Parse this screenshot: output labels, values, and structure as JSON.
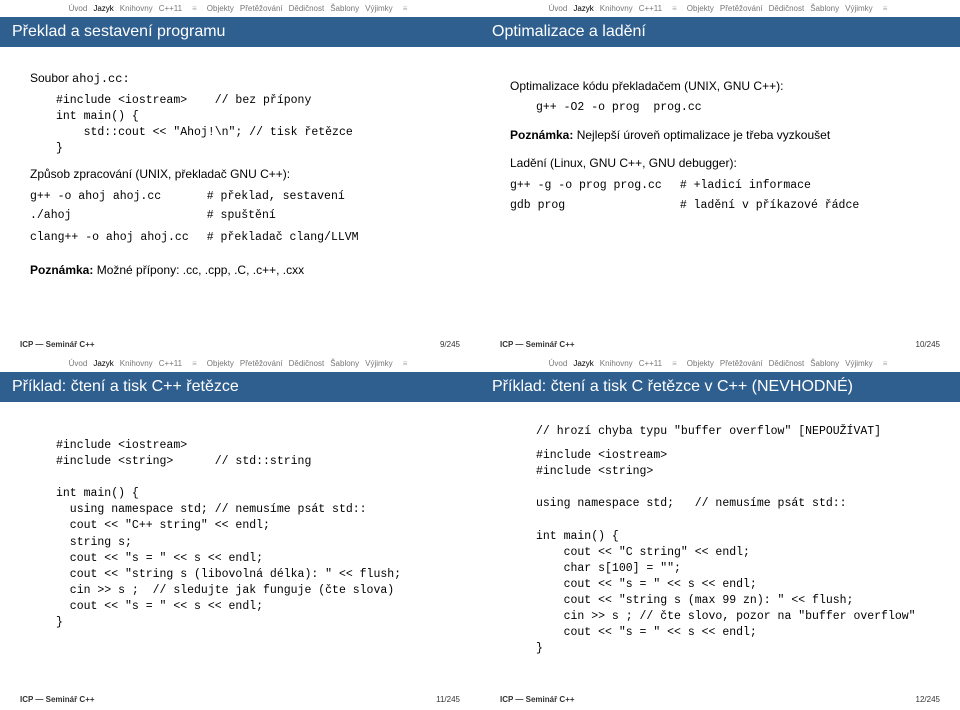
{
  "nav": {
    "items": [
      "Úvod",
      "Jazyk",
      "Knihovny",
      "C++11"
    ],
    "items2": [
      "Objekty",
      "Přetěžování",
      "Dědičnost",
      "Šablony",
      "Výjimky"
    ],
    "activeSection": "Jazyk"
  },
  "footer": {
    "left": "ICP — Seminář C++"
  },
  "slides": [
    {
      "title": "Překlad a sestavení programu",
      "soubor_label": "Soubor",
      "soubor_file": "ahoj.cc:",
      "code1": "#include <iostream>    // bez přípony\nint main() {\n    std::cout << \"Ahoj!\\n\"; // tisk řetězce\n}",
      "zpusob_label": "Způsob zpracování (UNIX, překladač GNU C++):",
      "cmds": [
        [
          "g++ -o ahoj ahoj.cc",
          "# překlad, sestavení"
        ],
        [
          "./ahoj",
          "# spuštění"
        ],
        [
          "",
          ""
        ],
        [
          "clang++ -o ahoj ahoj.cc",
          "# překladač clang/LLVM"
        ]
      ],
      "note_label": "Poznámka:",
      "note_text": "Možné přípony: .cc, .cpp, .C, .c++, .cxx",
      "page": "9/245"
    },
    {
      "title": "Optimalizace a ladění",
      "opt_label": "Optimalizace kódu překladačem (UNIX, GNU C++):",
      "opt_cmd": "g++ -O2 -o prog  prog.cc",
      "note_label": "Poznámka:",
      "note_text": "Nejlepší úroveň optimalizace je třeba vyzkoušet",
      "debug_label": "Ladění (Linux, GNU C++, GNU debugger):",
      "debug_cmds": [
        [
          "g++ -g -o prog prog.cc",
          "# +ladicí informace"
        ],
        [
          "gdb prog",
          "# ladění v příkazové řádce"
        ]
      ],
      "page": "10/245"
    },
    {
      "title": "Příklad: čtení a tisk C++ řetězce",
      "code": "#include <iostream>\n#include <string>      // std::string\n\nint main() {\n  using namespace std; // nemusíme psát std::\n  cout << \"C++ string\" << endl;\n  string s;\n  cout << \"s = \" << s << endl;\n  cout << \"string s (libovolná délka): \" << flush;\n  cin >> s ;  // sledujte jak funguje (čte slova)\n  cout << \"s = \" << s << endl;\n}",
      "page": "11/245"
    },
    {
      "title": "Příklad: čtení a tisk C řetězce v C++ (NEVHODNÉ)",
      "warn": "// hrozí chyba typu \"buffer overflow\" [NEPOUŽÍVAT]",
      "code": "#include <iostream>\n#include <string>\n\nusing namespace std;   // nemusíme psát std::\n\nint main() {\n    cout << \"C string\" << endl;\n    char s[100] = \"\";\n    cout << \"s = \" << s << endl;\n    cout << \"string s (max 99 zn): \" << flush;\n    cin >> s ; // čte slovo, pozor na \"buffer overflow\"\n    cout << \"s = \" << s << endl;\n}",
      "page": "12/245"
    }
  ]
}
